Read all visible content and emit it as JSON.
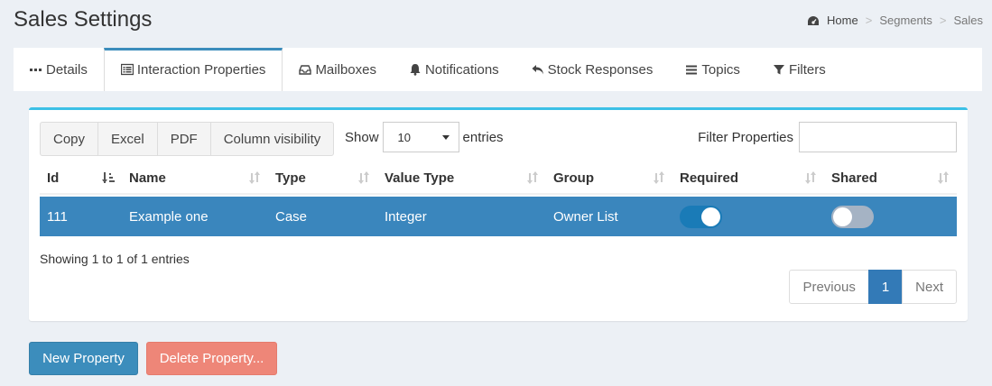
{
  "header": {
    "title": "Sales Settings",
    "breadcrumb": [
      "Home",
      "Segments",
      "Sales"
    ]
  },
  "tabs": [
    {
      "label": "Details",
      "icon": "ellipsis-icon"
    },
    {
      "label": "Interaction Properties",
      "icon": "list-alt-icon",
      "active": true
    },
    {
      "label": "Mailboxes",
      "icon": "inbox-icon"
    },
    {
      "label": "Notifications",
      "icon": "bell-icon"
    },
    {
      "label": "Stock Responses",
      "icon": "reply-icon"
    },
    {
      "label": "Topics",
      "icon": "bars-icon"
    },
    {
      "label": "Filters",
      "icon": "filter-icon"
    }
  ],
  "toolbar": {
    "buttons": [
      "Copy",
      "Excel",
      "PDF",
      "Column visibility"
    ],
    "show_label": "Show",
    "entries_value": "10",
    "entries_label": "entries",
    "filter_label": "Filter Properties",
    "filter_value": ""
  },
  "table": {
    "columns": [
      "Id",
      "Name",
      "Type",
      "Value Type",
      "Group",
      "Required",
      "Shared"
    ],
    "rows": [
      {
        "id": "111",
        "name": "Example one",
        "type": "Case",
        "value_type": "Integer",
        "group": "Owner List",
        "required": true,
        "shared": false
      }
    ]
  },
  "info": "Showing 1 to 1 of 1 entries",
  "pagination": {
    "previous": "Previous",
    "current": "1",
    "next": "Next"
  },
  "actions": {
    "new": "New Property",
    "delete": "Delete Property..."
  },
  "colors": {
    "accent": "#3c8dbc",
    "selected_row": "#3a86bd",
    "danger": "#ee8678",
    "panel_top": "#3cc0e6"
  }
}
